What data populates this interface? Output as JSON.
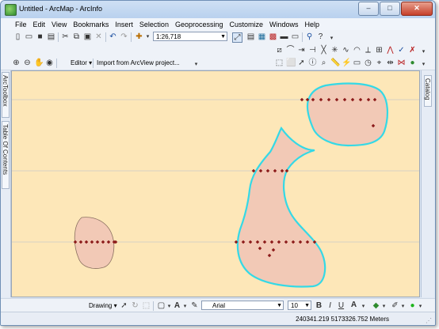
{
  "window": {
    "title": "Untitled - ArcMap - ArcInfo",
    "minimize_glyph": "–",
    "maximize_glyph": "□",
    "close_glyph": "✕"
  },
  "menubar": {
    "items": [
      "File",
      "Edit",
      "View",
      "Bookmarks",
      "Insert",
      "Selection",
      "Geoprocessing",
      "Customize",
      "Windows",
      "Help"
    ]
  },
  "toolbar": {
    "scale_value": "1:26,718",
    "editor_label": "Editor ▾",
    "import_label": "Import from ArcView project..."
  },
  "left_tabs": {
    "toolbox": "ArcToolbox",
    "toc": "Table Of Contents"
  },
  "right_tabs": {
    "catalog": "Catalog"
  },
  "draw_toolbar": {
    "drawing_label": "Drawing ▾",
    "font_name": "Arial",
    "font_size": "10",
    "bold": "B",
    "italic": "I",
    "underline": "U",
    "font_color_letter": "A"
  },
  "status": {
    "coordinates": "240341.219  5173326.752 Meters"
  },
  "map": {
    "background_color": "#fde7b8",
    "polygon_fill": "#f2c9b6",
    "highlight_color": "#34d9e6",
    "vertex_color": "#8b1a1a"
  }
}
